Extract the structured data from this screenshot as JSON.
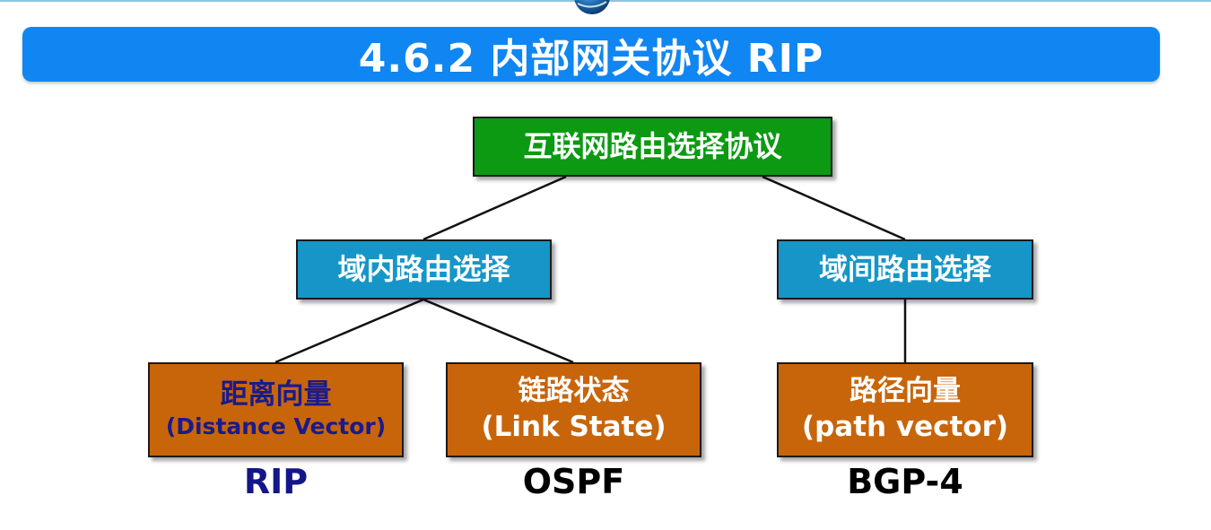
{
  "title": "4.6.2  内部网关协议 RIP",
  "diagram": {
    "root": "互联网路由选择协议",
    "intra_domain": "域内路由选择",
    "inter_domain": "域间路由选择",
    "leaves": [
      {
        "name": "距离向量",
        "subtitle": "(Distance Vector)",
        "protocol": "RIP"
      },
      {
        "name": "链路状态",
        "subtitle": "(Link State)",
        "protocol": "OSPF"
      },
      {
        "name": "路径向量",
        "subtitle": "(path vector)",
        "protocol": "BGP-4"
      }
    ]
  },
  "colors": {
    "title_bar": "#0f86f2",
    "root_node": "#0b9a12",
    "domain_node": "#1696c8",
    "leaf_node": "#c8650a",
    "distance_vector_text": "#1a1a8c",
    "rip_label": "#15158a"
  },
  "icons": {
    "logo": "globe-logo-icon"
  }
}
